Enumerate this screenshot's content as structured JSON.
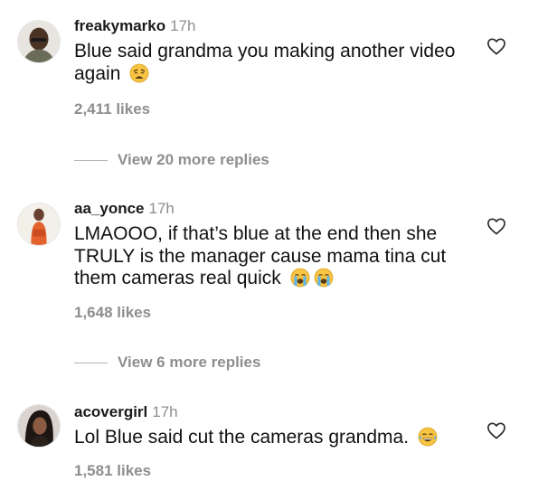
{
  "comments": [
    {
      "username": "freakymarko",
      "time": "17h",
      "text": "Blue said grandma you making another video again",
      "emoji_icons": [
        "weary-face-emoji"
      ],
      "likes": "2,411 likes",
      "replies_label": "View 20 more replies"
    },
    {
      "username": "aa_yonce",
      "time": "17h",
      "text": "LMAOOO, if that’s blue at the end then she TRULY is the manager cause mama tina cut them cameras real quick",
      "emoji_icons": [
        "loudly-crying-face-emoji",
        "loudly-crying-face-emoji"
      ],
      "likes": "1,648 likes",
      "replies_label": "View 6 more replies"
    },
    {
      "username": "acovergirl",
      "time": "17h",
      "text": "Lol Blue said cut the cameras grandma.",
      "emoji_icons": [
        "face-with-tears-of-joy-emoji"
      ],
      "likes": "1,581 likes"
    }
  ],
  "icons": {
    "like": "heart-outline-icon",
    "heart_stroke_color": "#262626",
    "muted_text_color": "#8e8e8e",
    "emoji_color": "#f6c343"
  }
}
